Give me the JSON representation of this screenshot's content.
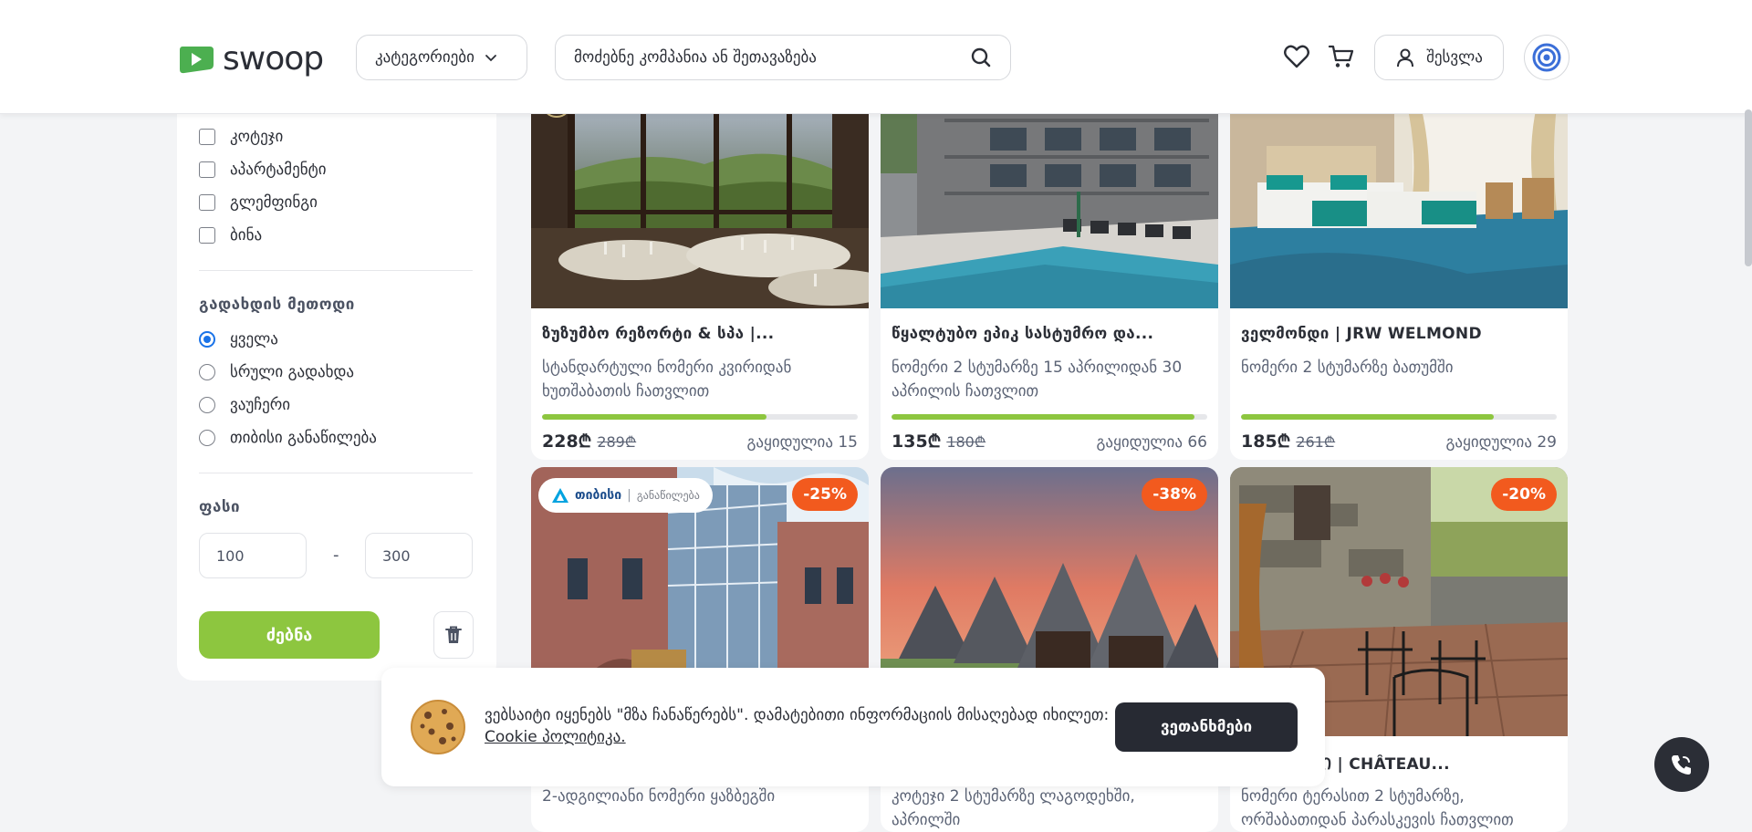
{
  "header": {
    "logo_text": "swoop",
    "categories_label": "კატეგორიები",
    "search_placeholder": "მოძებნე კომპანია ან შეთავაზება",
    "login_label": "შესვლა"
  },
  "sidebar": {
    "checkboxes": [
      {
        "label": "კოტეჯი",
        "checked": false
      },
      {
        "label": "აპარტამენტი",
        "checked": false
      },
      {
        "label": "გლემფინგი",
        "checked": false
      },
      {
        "label": "ბინა",
        "checked": false
      }
    ],
    "payment_title": "გადახდის მეთოდი",
    "payment_options": [
      {
        "label": "ყველა",
        "selected": true
      },
      {
        "label": "სრული გადახდა",
        "selected": false
      },
      {
        "label": "ვაუჩერი",
        "selected": false
      },
      {
        "label": "თიბისი განაწილება",
        "selected": false
      }
    ],
    "price_title": "ფასი",
    "price_min": "100",
    "price_max": "300",
    "price_dash": "-",
    "search_button": "ძებნა"
  },
  "cards": [
    {
      "title": "ზუზუმბო რეზორტი & სპა |...",
      "desc": "სტანდარტული ნომერი კვირიდან ხუთშაბათის ჩათვლით",
      "progress": 0.71,
      "price_new": "228₾",
      "price_old": "289₾",
      "sold": "გაყიდულია 15"
    },
    {
      "title": "წყალტუბო ეპიკ სასტუმრო და...",
      "desc": "ნომერი 2 სტუმარზე 15 აპრილიდან 30 აპრილის ჩათვლით",
      "progress": 0.96,
      "price_new": "135₾",
      "price_old": "180₾",
      "sold": "გაყიდულია 66"
    },
    {
      "title": "ველმონდი | JRW WELMOND",
      "desc": "ნომერი 2 სტუმარზე ბათუმში",
      "progress": 0.8,
      "price_new": "185₾",
      "price_old": "261₾",
      "sold": "გაყიდულია 29"
    },
    {
      "badge": "-25%",
      "tbc_main": "თიბისი",
      "tbc_sub": "განაწილება",
      "desc": "2-ადგილიანი ნომერი ყაზბეგში"
    },
    {
      "badge": "-38%",
      "desc": "კოტეჯი 2 სტუმარზე ლაგოდეხში, აპრილში"
    },
    {
      "badge": "-20%",
      "title": "ᲕᲗᲘᲗᲘᲐᲜᲘ | CHÂTEAU...",
      "desc": "ნომერი ტერასით 2 სტუმარზე, ორშაბათიდან პარასკევის ჩათვლით"
    }
  ],
  "cookie": {
    "text": "ვებსაიტი იყენებს \"მზა ჩანაწერებს\". დამატებითი ინფორმაციის მისაღებად იხილეთ: ",
    "link": "Cookie პოლიტიკა.",
    "button": "ვეთანხმები"
  },
  "colors": {
    "accent_green": "#8dc63f",
    "badge_orange": "#f25a1e",
    "dark": "#272a33"
  }
}
